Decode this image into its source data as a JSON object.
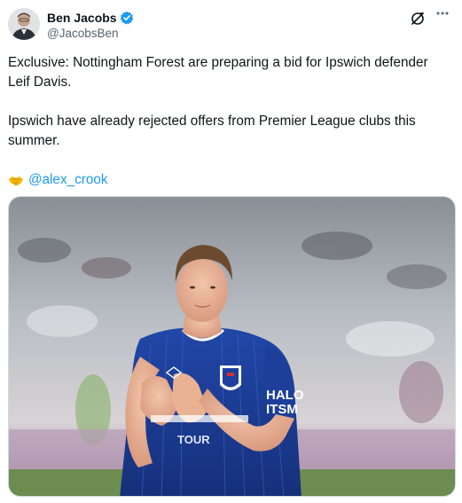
{
  "author": {
    "display_name": "Ben Jacobs",
    "handle": "@JacobsBen",
    "verified": true,
    "avatar_icon": "avatar-photo"
  },
  "header_icons": {
    "grok": "grok-icon",
    "more": "more-icon"
  },
  "tweet": {
    "paragraph_1": "Exclusive: Nottingham Forest are preparing a bid for Ipswich defender Leif Davis.",
    "paragraph_2": "Ipswich have already rejected offers from Premier League clubs this summer.",
    "mention_emoji": "handshake-icon",
    "mention": "@alex_crook"
  },
  "media": {
    "type": "photo",
    "shirt_text_1": "HALO",
    "shirt_text_2": "ITSM",
    "shirt_text_3": "TOUR"
  },
  "colors": {
    "accent": "#1d9bf0",
    "text": "#0f1419",
    "secondary": "#536471",
    "kit_blue": "#1e3f9c"
  }
}
